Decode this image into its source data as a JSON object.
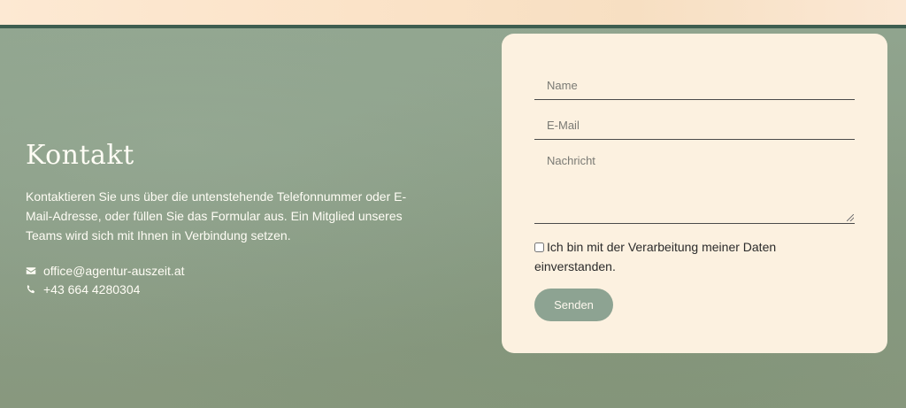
{
  "contact": {
    "title": "Kontakt",
    "description": "Kontaktieren Sie uns über die untenstehende Telefonnummer oder E-Mail-Adresse, oder füllen Sie das Formular aus. Ein Mitglied unseres Teams wird sich mit Ihnen in Verbindung setzen.",
    "email": "office@agentur-auszeit.at",
    "phone": "+43 664 4280304",
    "email_icon": "envelope-icon",
    "phone_icon": "phone-icon"
  },
  "form": {
    "name_placeholder": "Name",
    "name_value": "",
    "email_placeholder": "E-Mail",
    "email_value": "",
    "message_placeholder": "Nachricht",
    "message_value": "",
    "consent_label": "Ich bin mit der Verarbeitung meiner Daten einverstanden.",
    "consent_checked": false,
    "submit_label": "Senden"
  },
  "colors": {
    "section_bg": "#8b9d85",
    "divider": "#3e5e50",
    "card_bg": "#fcf1e0",
    "button_bg": "#8da392"
  }
}
